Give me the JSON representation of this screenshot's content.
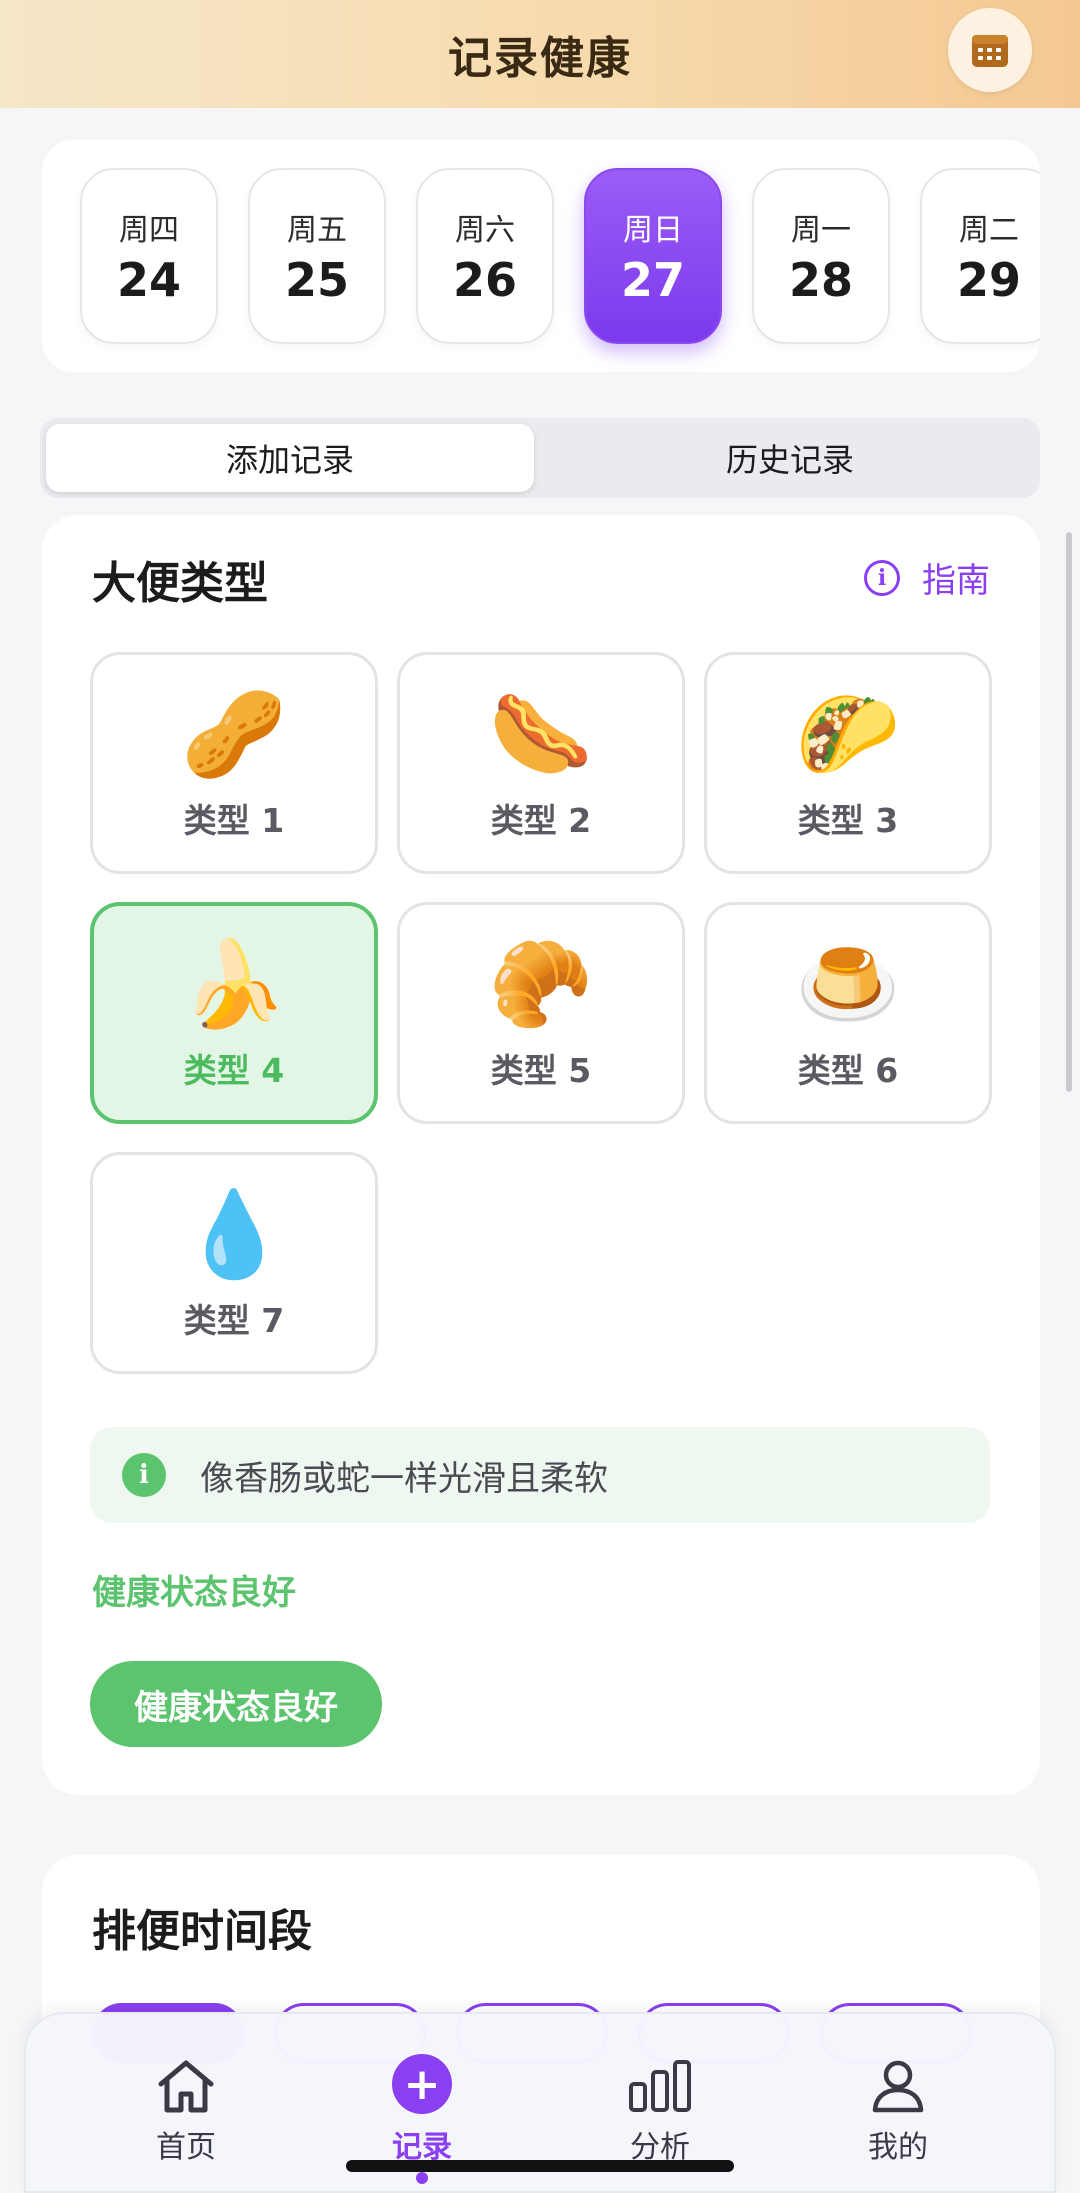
{
  "header": {
    "title": "记录健康",
    "calendar_icon": "calendar-icon"
  },
  "dates": [
    {
      "dow": "周四",
      "day": "24"
    },
    {
      "dow": "周五",
      "day": "25"
    },
    {
      "dow": "周六",
      "day": "26"
    },
    {
      "dow": "周日",
      "day": "27"
    },
    {
      "dow": "周一",
      "day": "28"
    },
    {
      "dow": "周二",
      "day": "29"
    }
  ],
  "selected_date_index": 3,
  "segments": {
    "add": "添加记录",
    "history": "历史记录"
  },
  "stool_section": {
    "title": "大便类型",
    "guide_label": "指南",
    "types": [
      {
        "label": "类型 1",
        "emoji": "🥜"
      },
      {
        "label": "类型 2",
        "emoji": "🌭"
      },
      {
        "label": "类型 3",
        "emoji": "🌮"
      },
      {
        "label": "类型 4",
        "emoji": "🍌"
      },
      {
        "label": "类型 5",
        "emoji": "🥐"
      },
      {
        "label": "类型 6",
        "emoji": "🍮"
      },
      {
        "label": "类型 7",
        "emoji": "💧"
      }
    ],
    "selected_type_index": 3,
    "hint": "像香肠或蛇一样光滑且柔软",
    "status_text": "健康状态良好",
    "status_badge": "健康状态良好"
  },
  "time_section": {
    "title": "排便时间段"
  },
  "tabbar": {
    "home": "首页",
    "record": "记录",
    "analysis": "分析",
    "mine": "我的"
  },
  "colors": {
    "accent": "#8a3ff0",
    "healthy": "#5cc46e",
    "header_gradient_start": "#f6e7c8",
    "header_gradient_end": "#f4c892"
  }
}
